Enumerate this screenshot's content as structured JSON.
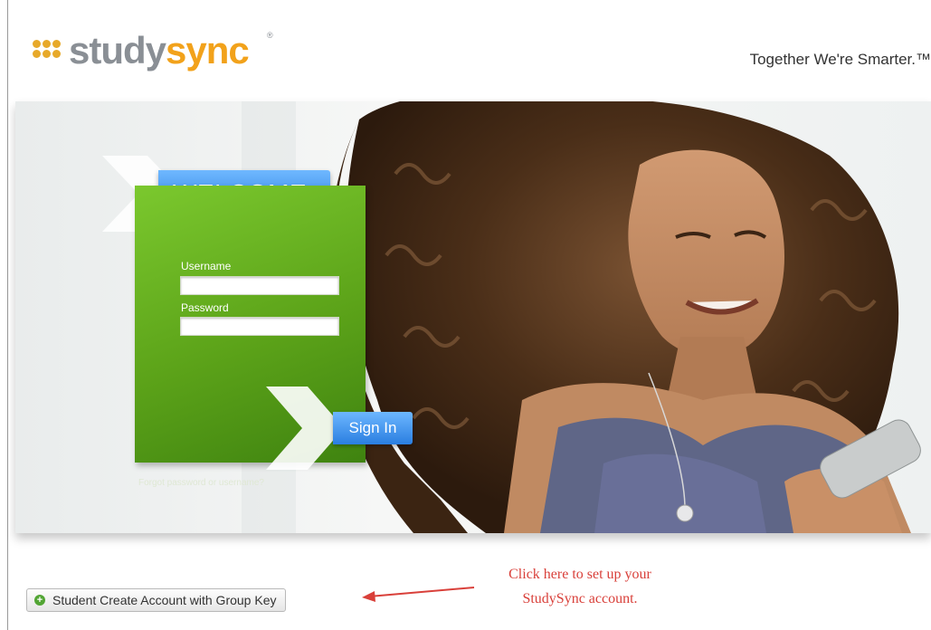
{
  "header": {
    "logo_part1": "study",
    "logo_part2": "sync",
    "logo_mark": "®",
    "tagline": "Together We're Smarter.™"
  },
  "login": {
    "welcome": "WELCOME",
    "username_label": "Username",
    "username_value": "",
    "password_label": "Password",
    "password_value": "",
    "signin_label": "Sign In",
    "forgot_link": "Forgot password or username?"
  },
  "footer": {
    "create_account_label": "Student Create Account with Group Key",
    "annotation_line1": "Click here to set up your",
    "annotation_line2": "StudySync account."
  },
  "icons": {
    "plus": "plus-circle-icon",
    "arrow": "red-arrow-left-icon"
  },
  "colors": {
    "brand_orange": "#f2a21b",
    "brand_gray": "#8a8f95",
    "panel_green": "#5ca319",
    "accent_blue": "#2a7fe0",
    "annotation_red": "#d9403a"
  }
}
